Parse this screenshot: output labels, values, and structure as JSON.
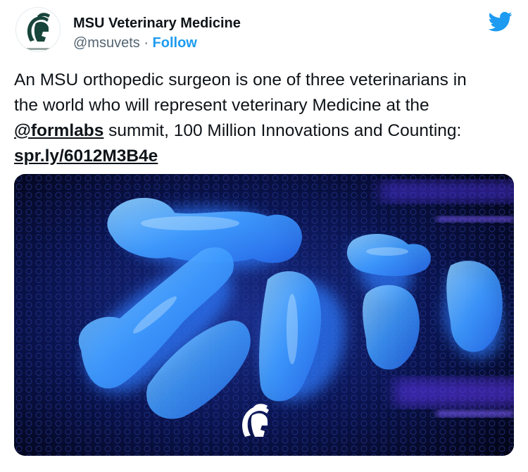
{
  "author": {
    "name": "MSU Veterinary Medicine",
    "handle": "@msuvets",
    "separator": "·",
    "follow_label": "Follow",
    "avatar_icon": "spartan-helmet-icon",
    "brand_color": "#18453b"
  },
  "platform": {
    "logo_icon": "twitter-bird-icon",
    "accent_color": "#1d9bf0"
  },
  "tweet": {
    "line1": "An MSU orthopedic surgeon is one of three veterinarians in",
    "line2": "the world who will represent veterinary Medicine at the",
    "mention": "@formlabs",
    "line3_rest": " summit, 100 Million Innovations and Counting:",
    "link": "spr.ly/6012M3B4e"
  },
  "media": {
    "subject": "3D-printed blue bone models under UV light",
    "watermark_icon": "spartan-helmet-icon"
  }
}
